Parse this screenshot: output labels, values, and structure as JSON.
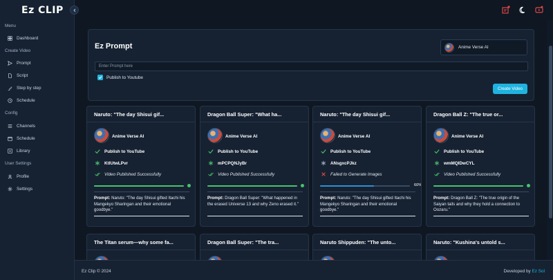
{
  "app": {
    "logo": "Ez CLIP"
  },
  "sidebar": {
    "sections": [
      {
        "label": "Menu"
      },
      {
        "label": "Create Video"
      },
      {
        "label": "Config"
      },
      {
        "label": "User Settings"
      }
    ],
    "items": [
      {
        "label": "Dashboard",
        "icon": "dashboard-icon"
      },
      {
        "label": "Prompt",
        "icon": "send-icon"
      },
      {
        "label": "Script",
        "icon": "file-icon"
      },
      {
        "label": "Step by step",
        "icon": "steps-icon"
      },
      {
        "label": "Schedule",
        "icon": "clock-icon"
      },
      {
        "label": "Channels",
        "icon": "list-icon"
      },
      {
        "label": "Schedule",
        "icon": "calendar-icon"
      },
      {
        "label": "Library",
        "icon": "library-icon"
      },
      {
        "label": "Profile",
        "icon": "user-icon"
      },
      {
        "label": "Settings",
        "icon": "gear-icon"
      }
    ]
  },
  "prompt": {
    "title": "Ez Prompt",
    "channel": "Anime Verse AI",
    "placeholder": "Enter Prompt here",
    "publish_label": "Publish to Youtube",
    "create_label": "Create Video"
  },
  "videos": [
    {
      "title": "Naruto: \"The day Shisui gif...",
      "channel": "Anime Verse AI",
      "publish": "Publish to YouTube",
      "id": "KtlUtwLPvr",
      "status": "Video Published Successfully",
      "status_ok": true,
      "progress": 100,
      "prompt_label": "Prompt:",
      "prompt": "Naruto: \"The day Shisui gifted Itachi his Mangekyo Sharingan and their emotional goodbye.\""
    },
    {
      "title": "Dragon Ball Super: \"What ha...",
      "channel": "Anime Verse AI",
      "publish": "Publish to YouTube",
      "id": "mPCPQNJyBr",
      "status": "Video Published Successfully",
      "status_ok": true,
      "progress": 100,
      "prompt_label": "Prompt:",
      "prompt": "Dragon Ball Super: \"What happened in the erased Universe 13 and why Zeno erased it.\""
    },
    {
      "title": "Naruto: \"The day Shisui gif...",
      "channel": "Anime Verse AI",
      "publish": "Publish to YouTube",
      "id": "ANsgxcPJkz",
      "status": "Failed to Generate Images",
      "status_ok": false,
      "progress": 60,
      "progress_label": "60%",
      "prompt_label": "Prompt:",
      "prompt": "Naruto: \"The day Shisui gifted Itachi his Mangekyo Sharingan and their emotional goodbye.\""
    },
    {
      "title": "Dragon Ball Z: \"The true or...",
      "channel": "Anime Verse AI",
      "publish": "Publish to YouTube",
      "id": "wmMQIDwCYL",
      "status": "Video Published Successfully",
      "status_ok": true,
      "progress": 100,
      "prompt_label": "Prompt:",
      "prompt": "Dragon Ball Z: \"The true origin of the Saiyan tails and why they hold a connection to Oozaru.\""
    }
  ],
  "videos_row2": [
    {
      "title": "The Titan serum—why some fa..."
    },
    {
      "title": "Dragon Ball Super: \"The tra..."
    },
    {
      "title": "Naruto Shippuden: \"The unto..."
    },
    {
      "title": "Naruto: \"Kushina's untold s..."
    }
  ],
  "footer": {
    "copyright": "Ez Clip © 2024",
    "developed_by": "Developed by",
    "developer": "Ez Sol"
  },
  "colors": {
    "accent": "#1fb3e0",
    "success": "#47c46b",
    "error": "#e04848",
    "progress_running": "#2f8fd6"
  }
}
